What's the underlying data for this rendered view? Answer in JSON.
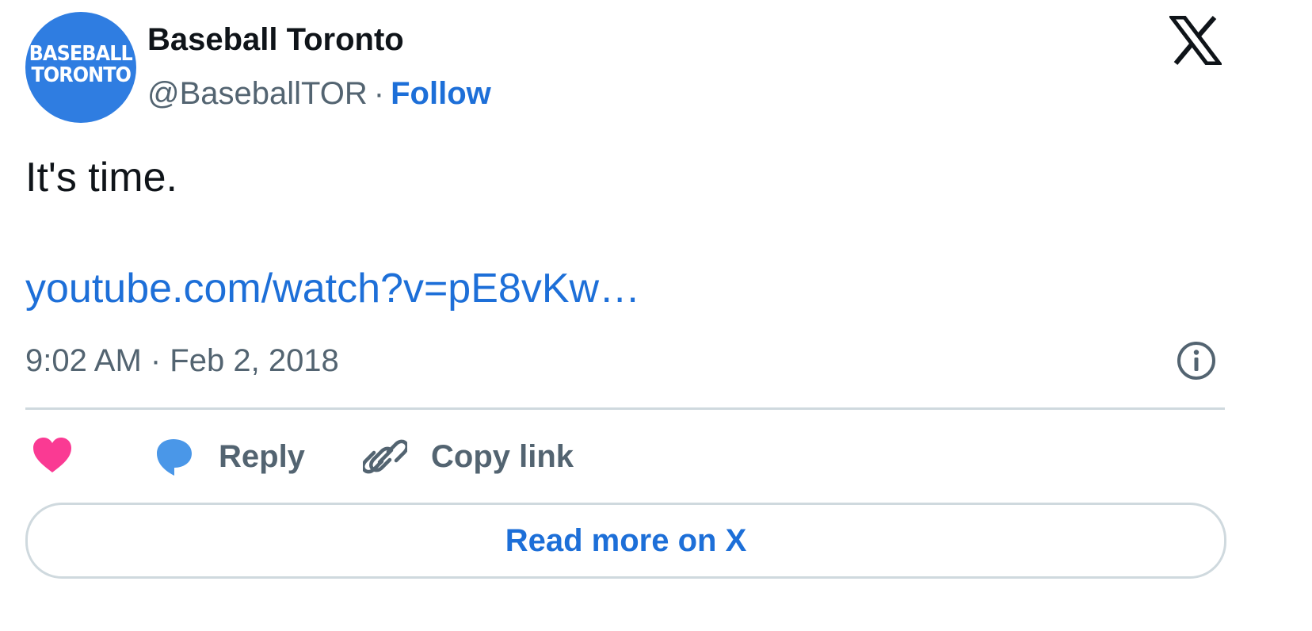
{
  "author": {
    "avatar_text_line1": "BASEBALL",
    "avatar_text_line2": "TORONTO",
    "display_name": "Baseball Toronto",
    "handle": "@BaseballTOR",
    "separator": "·",
    "follow_label": "Follow"
  },
  "brand": {
    "logo_icon": "x-logo-icon"
  },
  "tweet": {
    "text": "It's time.",
    "link": "youtube.com/watch?v=pE8vKw…",
    "timestamp": "9:02 AM · Feb 2, 2018"
  },
  "actions": {
    "like_icon": "heart-icon",
    "reply_label": "Reply",
    "copy_link_label": "Copy link"
  },
  "footer": {
    "read_more_label": "Read more on X"
  },
  "colors": {
    "accent": "#1d6fd8",
    "avatar_bg": "#2f7de1",
    "heart": "#f91880",
    "reply_bubble": "#4a97e8",
    "muted_text": "#536471",
    "divider": "#cfd9de"
  }
}
